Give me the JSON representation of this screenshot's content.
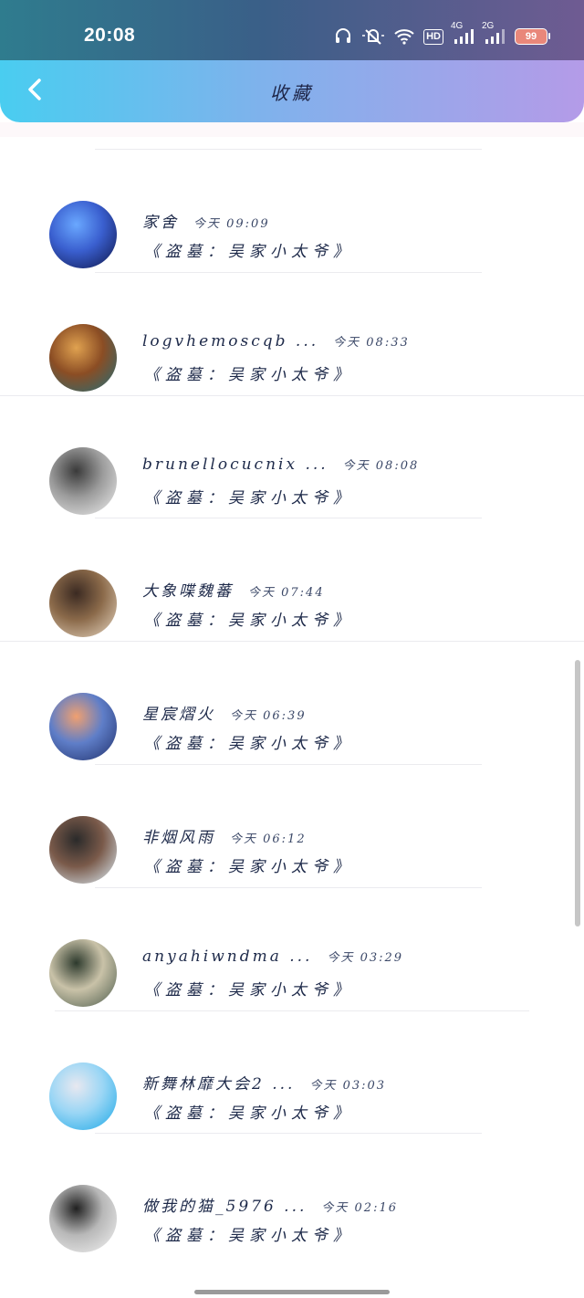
{
  "status_bar": {
    "time": "20:08",
    "hd_label": "HD",
    "net1_label": "4G",
    "net2_label": "2G",
    "battery": "99"
  },
  "header": {
    "title": "收藏"
  },
  "items": [
    {
      "name": "家舍",
      "time": "今天 09:09",
      "subtitle": "《盗墓：吴家小太爷》",
      "avatar_colors": [
        "#0d1446",
        "#3a5fcf",
        "#6aa8ff"
      ]
    },
    {
      "name": "logvhemoscqb ...",
      "time": "今天 08:33",
      "subtitle": "《盗墓：吴家小太爷》",
      "avatar_colors": [
        "#1f6e7a",
        "#8b4d24",
        "#e0a250"
      ]
    },
    {
      "name": "brunellocucnix ...",
      "time": "今天 08:08",
      "subtitle": "《盗墓：吴家小太爷》",
      "avatar_colors": [
        "#f0f0f0",
        "#9c9c9c",
        "#3a3a3a"
      ]
    },
    {
      "name": "大象喋魏蕃",
      "time": "今天 07:44",
      "subtitle": "《盗墓：吴家小太爷》",
      "avatar_colors": [
        "#e9d9c4",
        "#8b6a4a",
        "#3b2a22"
      ]
    },
    {
      "name": "星宸熠火",
      "time": "今天 06:39",
      "subtitle": "《盗墓：吴家小太爷》",
      "avatar_colors": [
        "#1f2f6a",
        "#5f7ec8",
        "#f0a070"
      ]
    },
    {
      "name": "非烟风雨",
      "time": "今天 06:12",
      "subtitle": "《盗墓：吴家小太爷》",
      "avatar_colors": [
        "#dff1fb",
        "#7a5a4a",
        "#2a2a2a"
      ]
    },
    {
      "name": "anyahiwndma ...",
      "time": "今天 03:29",
      "subtitle": "《盗墓：吴家小太爷》",
      "avatar_colors": [
        "#4a5a4a",
        "#c9c2a8",
        "#2d3a2d"
      ]
    },
    {
      "name": "新舞林靡大会2 ...",
      "time": "今天 03:03",
      "subtitle": "《盗墓：吴家小太爷》",
      "avatar_colors": [
        "#1aa7e6",
        "#9ad6f5",
        "#e8e8f0"
      ]
    },
    {
      "name": "做我的猫_5976 ...",
      "time": "今天 02:16",
      "subtitle": "《盗墓：吴家小太爷》",
      "avatar_colors": [
        "#f4f4f4",
        "#b8b8b8",
        "#202020"
      ]
    }
  ]
}
